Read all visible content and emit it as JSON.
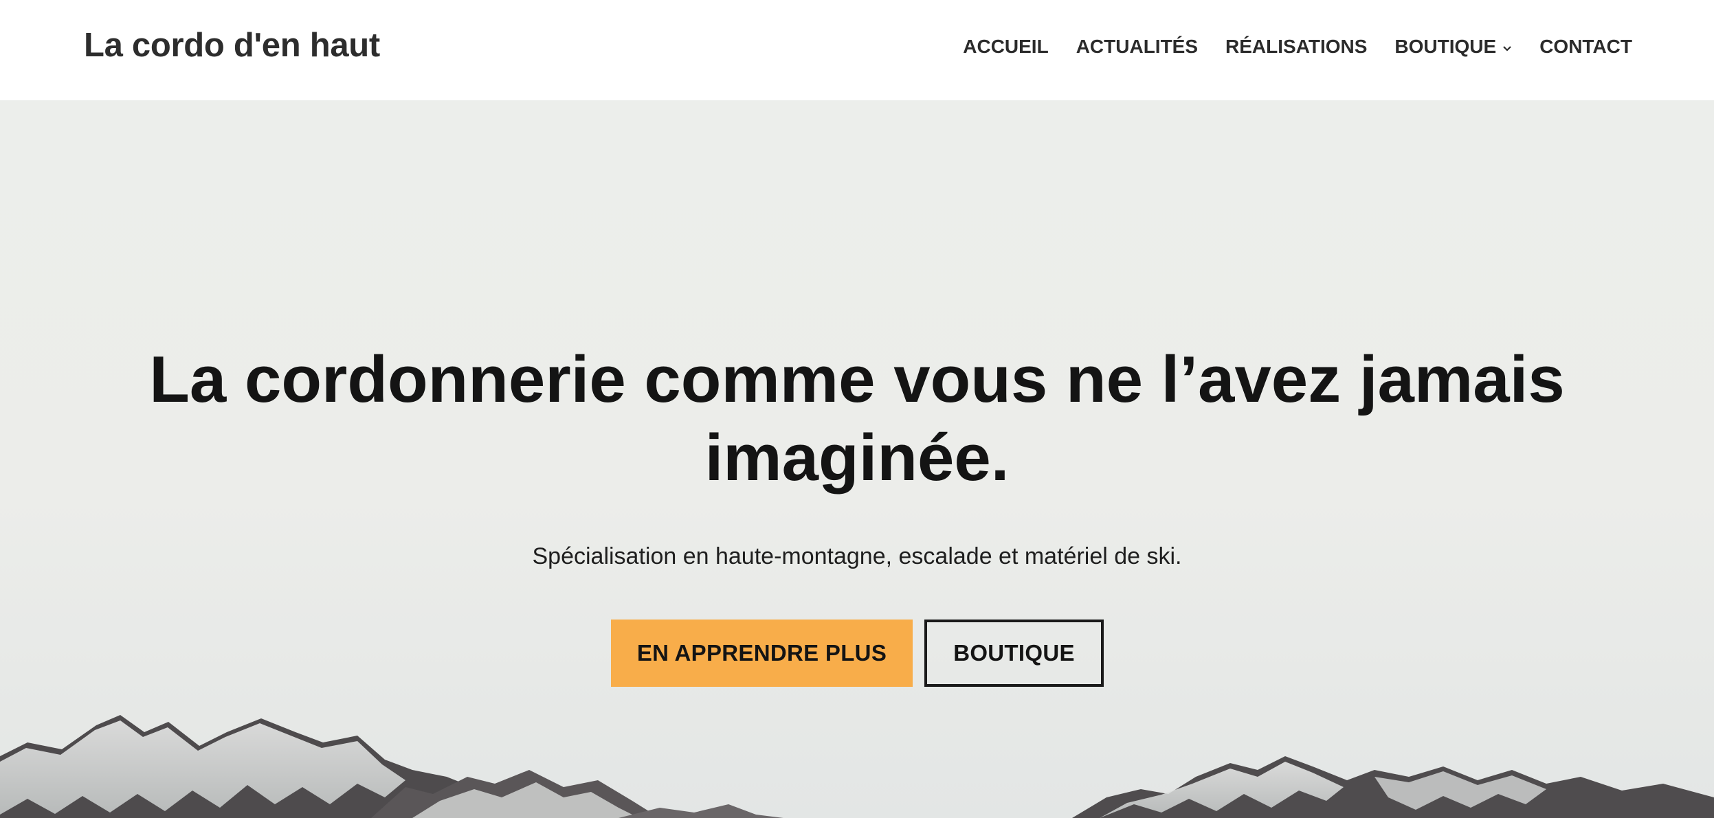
{
  "header": {
    "site_title": "La cordo d'en haut",
    "nav": [
      {
        "label": "ACCUEIL",
        "has_dropdown": false
      },
      {
        "label": "ACTUALITÉS",
        "has_dropdown": false
      },
      {
        "label": "RÉALISATIONS",
        "has_dropdown": false
      },
      {
        "label": "BOUTIQUE",
        "has_dropdown": true,
        "icon": "chevron-down-icon"
      },
      {
        "label": "CONTACT",
        "has_dropdown": false
      }
    ]
  },
  "hero": {
    "title_line1": "La cordonnerie comme vous ne l’avez jamais",
    "title_line2": "imaginée.",
    "subtitle": "Spécialisation en haute-montagne, escalade et matériel de ski.",
    "primary_button": "EN APPRENDRE PLUS",
    "secondary_button": "BOUTIQUE",
    "background_image": "snowy-mountains-image"
  },
  "colors": {
    "accent": "#f8ad4a",
    "text_dark": "#141414",
    "hero_bg": "#ecedea"
  }
}
